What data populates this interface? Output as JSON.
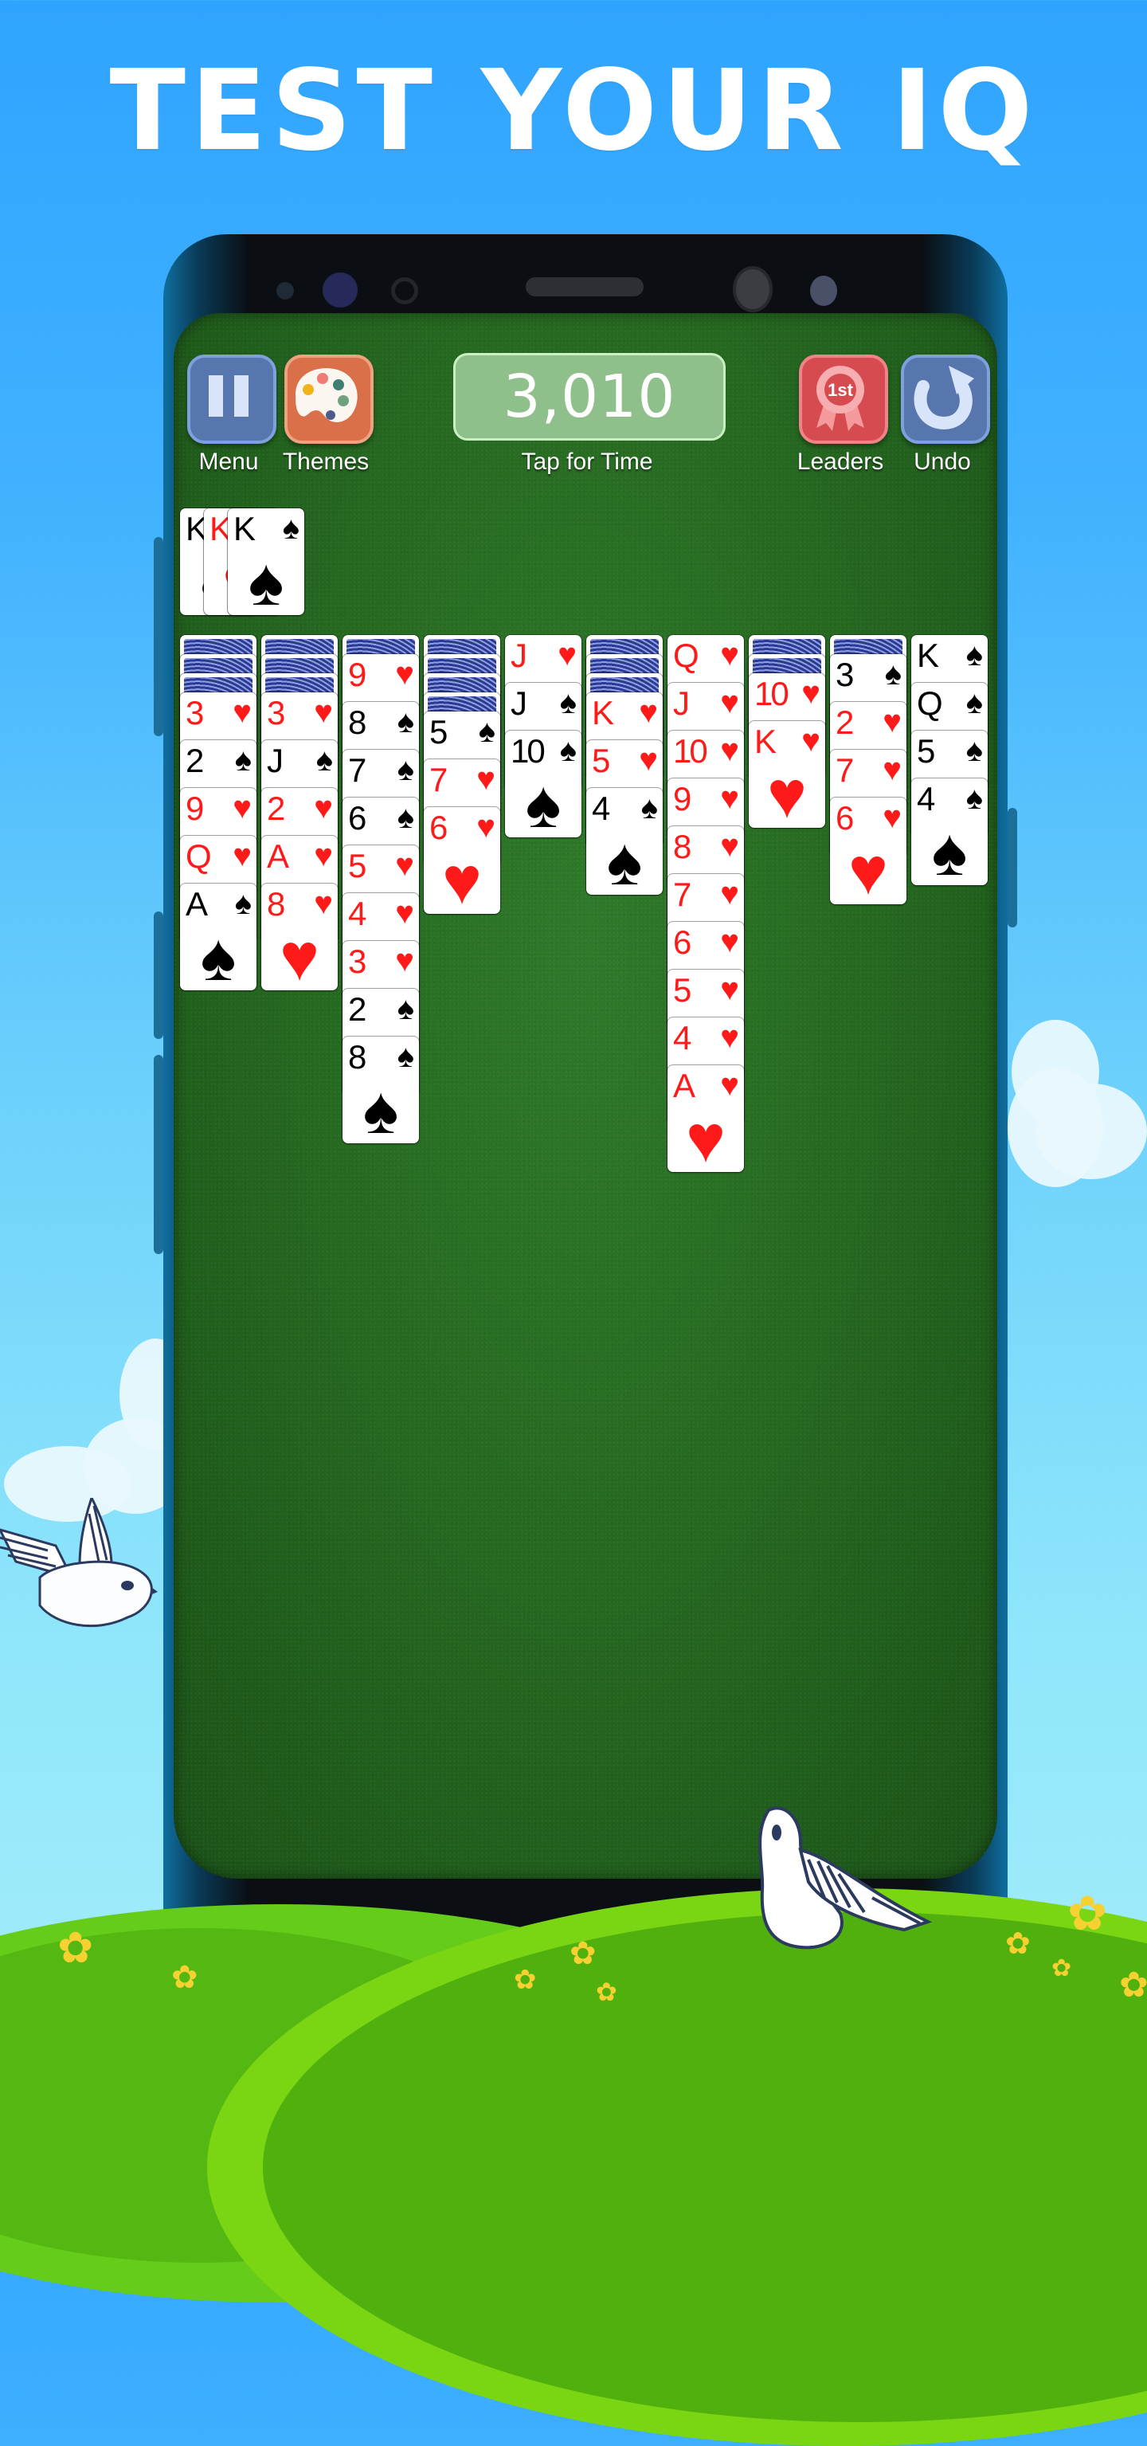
{
  "headline": "TEST YOUR IQ",
  "toolbar": {
    "menu_label": "Menu",
    "themes_label": "Themes",
    "score": "3,010",
    "score_caption": "Tap for Time",
    "leaders_label": "Leaders",
    "leaders_badge": "1st",
    "undo_label": "Undo"
  },
  "colors": {
    "felt": "#24661f",
    "red_suit": "#ff1a1a",
    "menu_button": "#5676ad",
    "themes_button": "#d9704a",
    "leaders_button": "#d64b4f",
    "score_box": "#8fbf8a"
  },
  "completed_foundations": [
    {
      "rank": "K",
      "suit": "spades"
    },
    {
      "rank": "K",
      "suit": "hearts"
    },
    {
      "rank": "K",
      "suit": "spades"
    }
  ],
  "tableau": [
    {
      "face_down": 3,
      "face_up": [
        [
          "3",
          "hearts"
        ],
        [
          "2",
          "spades"
        ],
        [
          "9",
          "hearts"
        ],
        [
          "Q",
          "hearts"
        ],
        [
          "A",
          "spades"
        ]
      ]
    },
    {
      "face_down": 3,
      "face_up": [
        [
          "3",
          "hearts"
        ],
        [
          "J",
          "spades"
        ],
        [
          "2",
          "hearts"
        ],
        [
          "A",
          "hearts"
        ],
        [
          "8",
          "hearts"
        ]
      ]
    },
    {
      "face_down": 1,
      "face_up": [
        [
          "9",
          "hearts"
        ],
        [
          "8",
          "spades"
        ],
        [
          "7",
          "spades"
        ],
        [
          "6",
          "spades"
        ],
        [
          "5",
          "hearts"
        ],
        [
          "4",
          "hearts"
        ],
        [
          "3",
          "hearts"
        ],
        [
          "2",
          "spades"
        ],
        [
          "8",
          "spades"
        ]
      ]
    },
    {
      "face_down": 4,
      "face_up": [
        [
          "5",
          "spades"
        ],
        [
          "7",
          "hearts"
        ],
        [
          "6",
          "hearts"
        ]
      ]
    },
    {
      "face_down": 0,
      "face_up": [
        [
          "J",
          "hearts"
        ],
        [
          "J",
          "spades"
        ],
        [
          "10",
          "spades"
        ]
      ]
    },
    {
      "face_down": 3,
      "face_up": [
        [
          "K",
          "hearts"
        ],
        [
          "5",
          "hearts"
        ],
        [
          "4",
          "spades"
        ]
      ]
    },
    {
      "face_down": 0,
      "face_up": [
        [
          "Q",
          "hearts"
        ],
        [
          "J",
          "hearts"
        ],
        [
          "10",
          "hearts"
        ],
        [
          "9",
          "hearts"
        ],
        [
          "8",
          "hearts"
        ],
        [
          "7",
          "hearts"
        ],
        [
          "6",
          "hearts"
        ],
        [
          "5",
          "hearts"
        ],
        [
          "4",
          "hearts"
        ],
        [
          "A",
          "hearts"
        ]
      ]
    },
    {
      "face_down": 2,
      "face_up": [
        [
          "10",
          "hearts"
        ],
        [
          "K",
          "hearts"
        ]
      ]
    },
    {
      "face_down": 1,
      "face_up": [
        [
          "3",
          "spades"
        ],
        [
          "2",
          "hearts"
        ],
        [
          "7",
          "hearts"
        ],
        [
          "6",
          "hearts"
        ]
      ]
    },
    {
      "face_down": 0,
      "face_up": [
        [
          "K",
          "spades"
        ],
        [
          "Q",
          "spades"
        ],
        [
          "5",
          "spades"
        ],
        [
          "4",
          "spades"
        ]
      ]
    }
  ],
  "icons": {
    "menu": "pause-icon",
    "themes": "palette-icon",
    "leaders": "award-ribbon-icon",
    "undo": "undo-arrow-icon"
  }
}
